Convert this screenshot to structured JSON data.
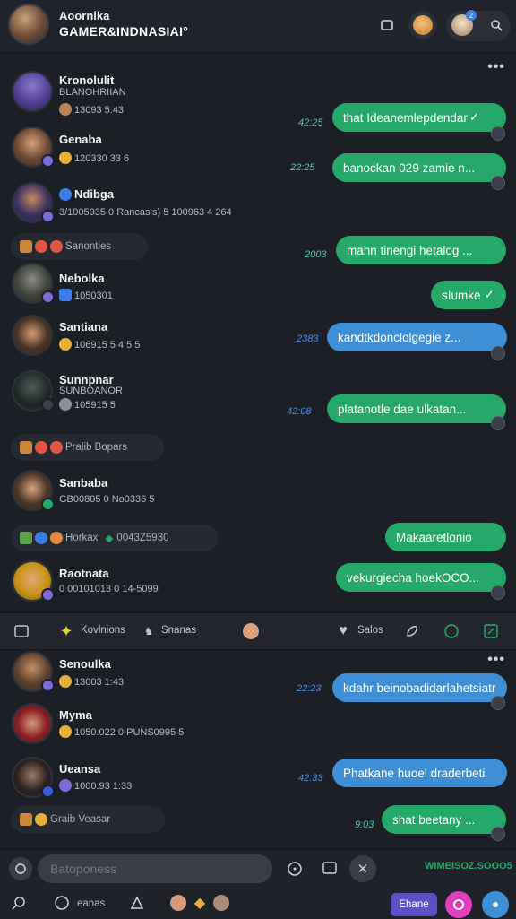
{
  "header": {
    "title_line1": "Aoornika",
    "title_line2": "GAMER&INDNASIAI°",
    "notification_count": "2"
  },
  "conversations_top": [
    {
      "name": "Kronolulit",
      "subtitle": "BLANOHRIIAN",
      "meta": "13093 5:43"
    },
    {
      "name": "Genaba",
      "meta": "120330 33 6"
    },
    {
      "name": "Ndibga",
      "meta": "3/1005035 0  Rancasis) 5  100963 4 264"
    },
    {
      "name": "Nebolka",
      "meta": "1050301"
    },
    {
      "name": "Santiana",
      "meta": "106915 5 4 5 5"
    },
    {
      "name": "Sunnpnar",
      "subtitle": "SUNBOANOR",
      "meta": "105915 5"
    },
    {
      "name": "Sanbaba",
      "meta": "GB00805 0  No0336 5"
    },
    {
      "name": "Raotnata",
      "meta": "0 00101013 0  14-5099"
    }
  ],
  "system_bars": [
    {
      "label": "Sanonties"
    },
    {
      "label": "Pralib Bopars"
    },
    {
      "label": "Horkax",
      "extra": "0043Z5930"
    },
    {
      "label": "Graib Veasar"
    }
  ],
  "bubbles_top": [
    {
      "text": "that Ideanemlepdendar",
      "time": "42:25",
      "color": "green"
    },
    {
      "text": "banockan 029 zamie n...",
      "time": "22:25",
      "color": "green"
    },
    {
      "text": "mahn tinengi hetalog ...",
      "time": "2003",
      "color": "green"
    },
    {
      "text": "sIumke",
      "time": "",
      "color": "green"
    },
    {
      "text": "kandtkdonclolgegie z...",
      "time": "2383",
      "color": "blue"
    },
    {
      "text": "platanotle dae ulkatan...",
      "time": "42:08",
      "color": "green"
    },
    {
      "text": "Makaaretlonio",
      "time": "",
      "color": "green"
    },
    {
      "text": "vekurgiecha hoekOCO...",
      "time": "",
      "color": "green"
    }
  ],
  "toolbar": {
    "item1": "Kovlnions",
    "item2": "Snanas",
    "item3": "Salos"
  },
  "conversations_bottom": [
    {
      "name": "Senoulka",
      "meta": "13003 1:43"
    },
    {
      "name": "Myma",
      "meta": "1050.022 0  PUNS0995 5"
    },
    {
      "name": "Ueansa",
      "meta": "1000.93 1:33"
    }
  ],
  "bubbles_bottom": [
    {
      "text": "kdahr beinobadidarlahetsiatr",
      "time": "22:23",
      "color": "blue"
    },
    {
      "text": "Phatkane huoel draderbeti",
      "time": "42:33",
      "color": "blue"
    },
    {
      "text": "shat beetany ...",
      "time": "9:03",
      "color": "green"
    }
  ],
  "composer": {
    "placeholder": "Batoponess",
    "status_text": "WIMEISOZ.SOOO5",
    "nav_label": "eanas",
    "send_label": "Ehane"
  },
  "colors": {
    "bubble_green": "#25a86a",
    "bubble_blue": "#3f8fd6",
    "background": "#1c1f26",
    "accent_purple": "#7d6bd8",
    "accent_pink": "#e23fbf"
  }
}
